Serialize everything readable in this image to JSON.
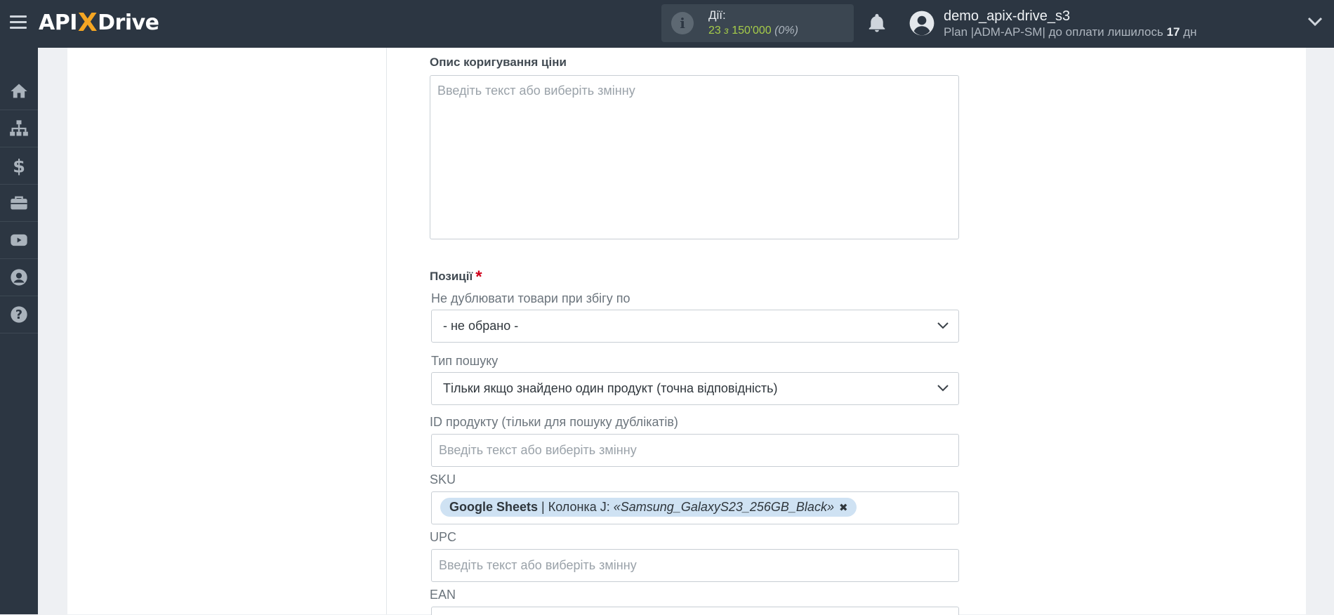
{
  "header": {
    "logo_left": "API",
    "logo_x": "X",
    "logo_right": "Drive",
    "actions_title": "Дії:",
    "actions_used": "23",
    "actions_of": "з",
    "actions_limit": "150'000",
    "actions_percent": "(0%)",
    "user_name": "demo_apix-drive_s3",
    "plan_prefix": "Plan |ADM-AP-SM| до оплати лишилось",
    "plan_days": "17",
    "plan_suffix": "дн"
  },
  "sidebar": {
    "items": [
      {
        "icon": "home-icon"
      },
      {
        "icon": "sitemap-icon"
      },
      {
        "icon": "dollar-icon"
      },
      {
        "icon": "briefcase-icon"
      },
      {
        "icon": "youtube-icon"
      },
      {
        "icon": "user-circle-icon"
      },
      {
        "icon": "help-icon"
      }
    ]
  },
  "form": {
    "price_adjust_label": "Опис коригування ціни",
    "price_adjust_placeholder": "Введіть текст або виберіть змінну",
    "positions_label": "Позиції",
    "required_mark": "*",
    "no_dup_label": "Не дублювати товари при збігу по",
    "no_dup_value": "- не обрано -",
    "search_type_label": "Тип пошуку",
    "search_type_value": "Тільки якщо знайдено один продукт (точна відповідність)",
    "product_id_label": "ID продукту (тільки для пошуку дублікатів)",
    "product_id_placeholder": "Введіть текст або виберіть змінну",
    "sku_label": "SKU",
    "sku_tag_source": "Google Sheets",
    "sku_tag_column": "| Колонка J:",
    "sku_tag_value": "«Samsung_GalaxyS23_256GB_Black»",
    "sku_tag_remove": "✖",
    "upc_label": "UPC",
    "upc_placeholder": "Введіть текст або виберіть змінну",
    "ean_label": "EAN"
  }
}
